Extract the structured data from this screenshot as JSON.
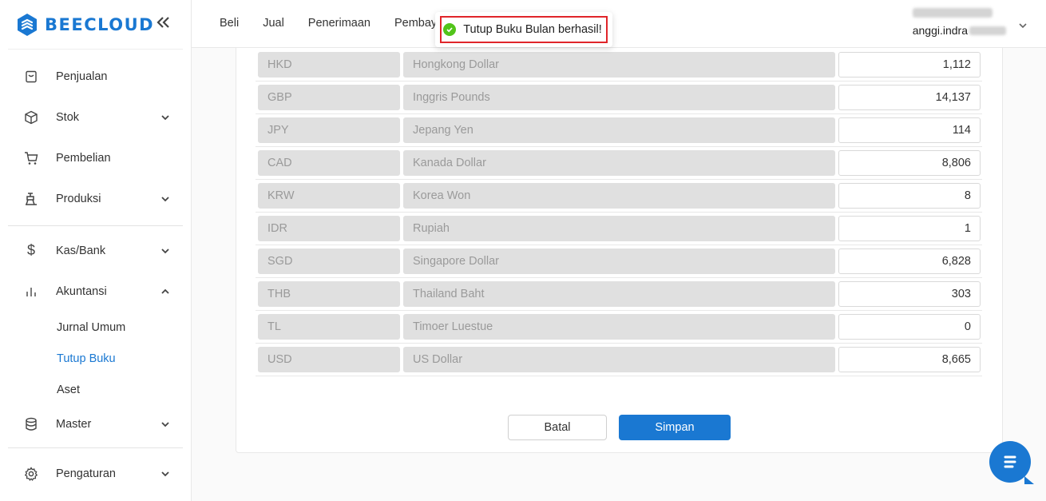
{
  "brand": {
    "name": "BEECLOUD"
  },
  "sidebar": {
    "groups": [
      {
        "items": [
          {
            "label": "Penjualan",
            "icon": "receipt-icon",
            "expandable": false
          },
          {
            "label": "Stok",
            "icon": "box-icon",
            "expandable": true
          },
          {
            "label": "Pembelian",
            "icon": "cart-icon",
            "expandable": false
          },
          {
            "label": "Produksi",
            "icon": "factory-icon",
            "expandable": true
          }
        ]
      },
      {
        "items": [
          {
            "label": "Kas/Bank",
            "icon": "dollar-icon",
            "expandable": true
          },
          {
            "label": "Akuntansi",
            "icon": "bar-chart-icon",
            "expandable": true,
            "expanded": true
          }
        ]
      }
    ],
    "akuntansi_sub": [
      "Jurnal Umum",
      "Tutup Buku",
      "Aset"
    ],
    "active_sub": "Tutup Buku",
    "master": "Master",
    "pengaturan": "Pengaturan"
  },
  "topnav": {
    "items": [
      "Beli",
      "Jual",
      "Penerimaan",
      "Pembay"
    ]
  },
  "user": {
    "email_prefix": "anggi.indra"
  },
  "toast": {
    "message": "Tutup Buku Bulan berhasil!",
    "border_color": "#e0252a"
  },
  "rates": [
    {
      "code": "HKD",
      "name": "Hongkong Dollar",
      "rate": "1,112"
    },
    {
      "code": "GBP",
      "name": "Inggris Pounds",
      "rate": "14,137"
    },
    {
      "code": "JPY",
      "name": "Jepang Yen",
      "rate": "114"
    },
    {
      "code": "CAD",
      "name": "Kanada Dollar",
      "rate": "8,806"
    },
    {
      "code": "KRW",
      "name": "Korea Won",
      "rate": "8"
    },
    {
      "code": "IDR",
      "name": "Rupiah",
      "rate": "1"
    },
    {
      "code": "SGD",
      "name": "Singapore Dollar",
      "rate": "6,828"
    },
    {
      "code": "THB",
      "name": "Thailand Baht",
      "rate": "303"
    },
    {
      "code": "TL",
      "name": "Timoer Luestue",
      "rate": "0"
    },
    {
      "code": "USD",
      "name": "US Dollar",
      "rate": "8,665"
    }
  ],
  "actions": {
    "cancel": "Batal",
    "save": "Simpan"
  },
  "colors": {
    "primary": "#1a78d2",
    "success": "#52c41a"
  }
}
